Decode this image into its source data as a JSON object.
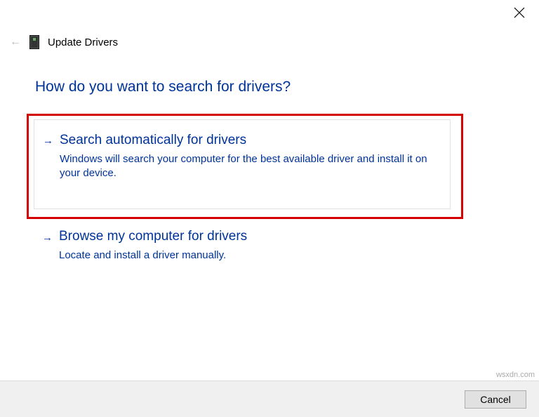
{
  "window": {
    "title": "Update Drivers"
  },
  "question": "How do you want to search for drivers?",
  "options": [
    {
      "title": "Search automatically for drivers",
      "description": "Windows will search your computer for the best available driver and install it on your device."
    },
    {
      "title": "Browse my computer for drivers",
      "description": "Locate and install a driver manually."
    }
  ],
  "buttons": {
    "cancel": "Cancel"
  },
  "watermark": "wsxdn.com"
}
